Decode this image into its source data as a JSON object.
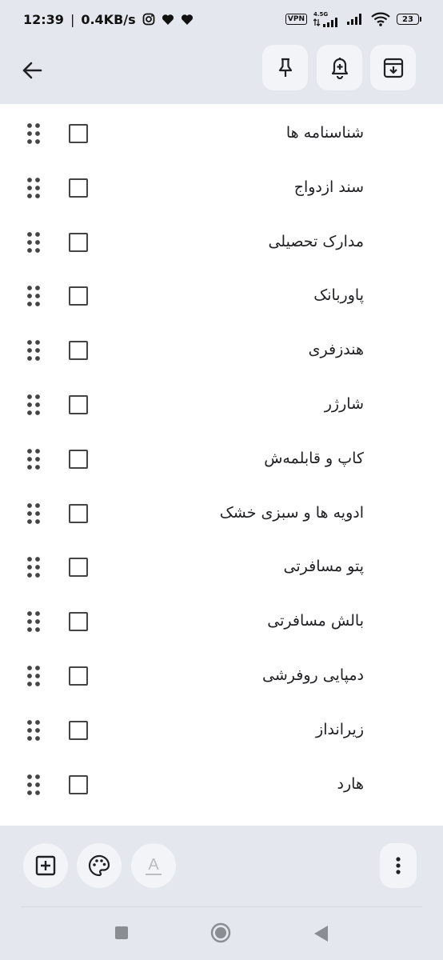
{
  "status_bar": {
    "time": "12:39",
    "separator": "|",
    "speed": "0.4KB/s",
    "vpn": "VPN",
    "network": "4.5G",
    "battery": "23"
  },
  "toolbar": {
    "back_icon": "arrow-back-icon",
    "pin_icon": "pin-icon",
    "reminder_icon": "bell-plus-icon",
    "archive_icon": "archive-icon"
  },
  "checklist": {
    "items": [
      {
        "label": "شناسنامه ها",
        "checked": false
      },
      {
        "label": "سند ازدواج",
        "checked": false
      },
      {
        "label": "مدارک تحصیلی",
        "checked": false
      },
      {
        "label": "پاوربانک",
        "checked": false
      },
      {
        "label": "هندزفری",
        "checked": false
      },
      {
        "label": "شارژر",
        "checked": false
      },
      {
        "label": "کاپ و قابلمه‌ش",
        "checked": false
      },
      {
        "label": "ادویه ها و سبزی خشک",
        "checked": false
      },
      {
        "label": "پتو مسافرتی",
        "checked": false
      },
      {
        "label": "بالش مسافرتی",
        "checked": false
      },
      {
        "label": "دمپایی روفرشی",
        "checked": false
      },
      {
        "label": "زیرانداز",
        "checked": false
      },
      {
        "label": "هارد",
        "checked": false
      }
    ]
  },
  "bottom_bar": {
    "add_icon": "add-box-icon",
    "palette_icon": "palette-icon",
    "format_icon": "text-format-icon",
    "format_glyph": "A",
    "more_icon": "more-vert-icon"
  },
  "colors": {
    "chrome_bg": "#e4e8ee",
    "content_bg": "#ffffff",
    "button_bg": "#f2f4f7",
    "icon": "#202124"
  }
}
